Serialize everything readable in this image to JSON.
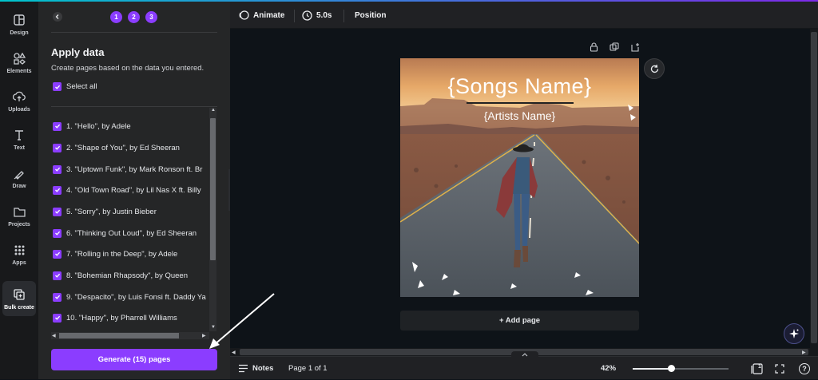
{
  "rail": {
    "items": [
      {
        "label": "Design",
        "icon": "layout-icon"
      },
      {
        "label": "Elements",
        "icon": "shapes-icon"
      },
      {
        "label": "Uploads",
        "icon": "cloud-upload-icon"
      },
      {
        "label": "Text",
        "icon": "text-t-icon"
      },
      {
        "label": "Draw",
        "icon": "pen-icon"
      },
      {
        "label": "Projects",
        "icon": "folder-icon"
      },
      {
        "label": "Apps",
        "icon": "grid-icon"
      },
      {
        "label": "Bulk create",
        "icon": "bulk-create-icon"
      }
    ],
    "active": "Bulk create"
  },
  "panel": {
    "steps": [
      "1",
      "2",
      "3"
    ],
    "title": "Apply data",
    "description": "Create pages based on the data you entered.",
    "select_all_label": "Select all",
    "rows": [
      "1. \"Hello\", by Adele",
      "2. \"Shape of You\", by Ed Sheeran",
      "3. \"Uptown Funk\", by Mark Ronson ft. Br",
      "4. \"Old Town Road\", by Lil Nas X ft. Billy",
      "5. \"Sorry\", by Justin Bieber",
      "6. \"Thinking Out Loud\", by Ed Sheeran",
      "7. \"Rolling in the Deep\", by Adele",
      "8. \"Bohemian Rhapsody\", by Queen",
      "9. \"Despacito\", by Luis Fonsi ft. Daddy Ya",
      "10. \"Happy\", by Pharrell Williams"
    ],
    "generate_label": "Generate (15) pages"
  },
  "toolbar": {
    "animate_label": "Animate",
    "duration_label": "5.0s",
    "position_label": "Position"
  },
  "canvas": {
    "songs_placeholder": "{Songs Name}",
    "artists_placeholder": "{Artists Name}",
    "add_page_label": "+ Add page"
  },
  "bottom": {
    "notes_label": "Notes",
    "page_indicator": "Page 1 of 1",
    "zoom_label": "42%",
    "pages_count": "1",
    "help_label": "?"
  },
  "colors": {
    "accent": "#8b3dff",
    "panel_bg": "#252627",
    "rail_bg": "#18191b",
    "canvas_bg": "#0e1318"
  }
}
